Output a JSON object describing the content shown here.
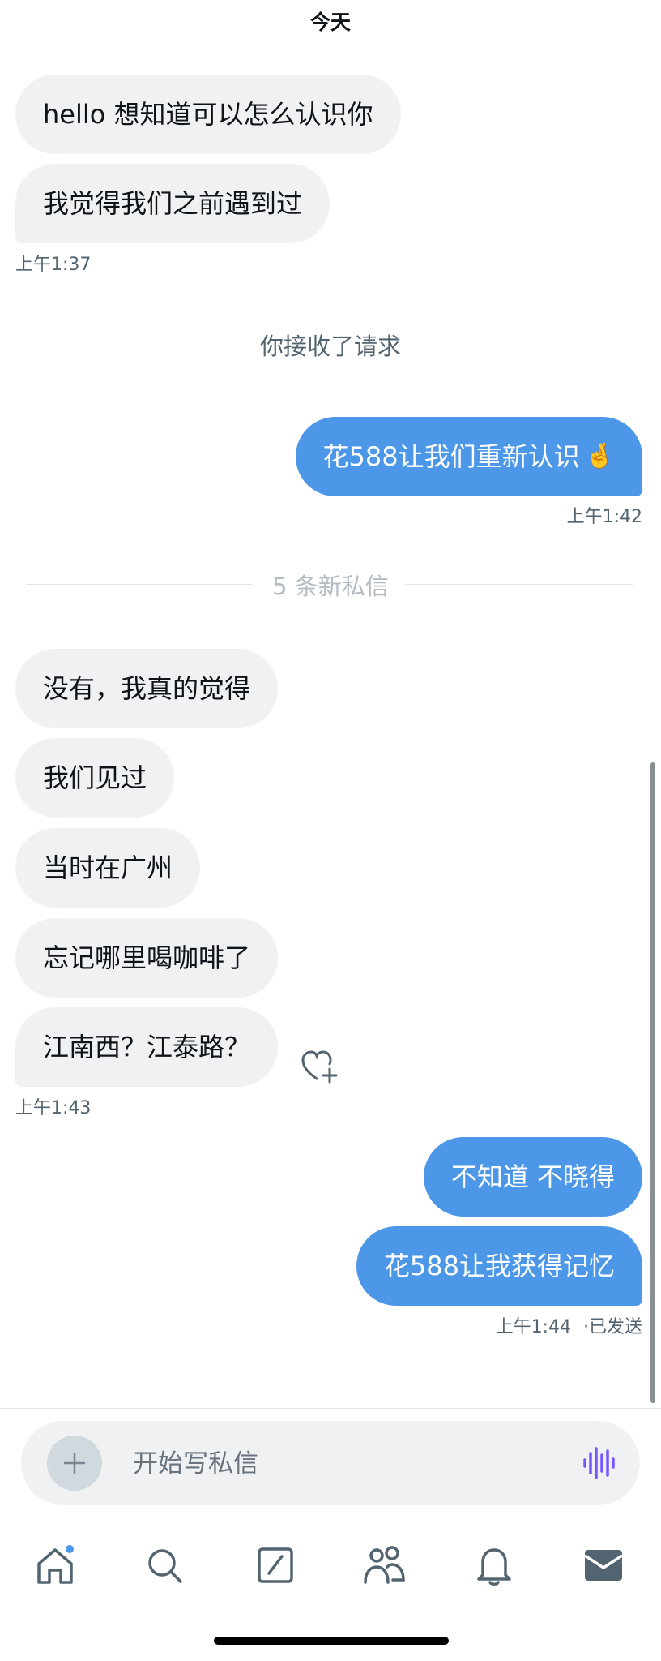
{
  "header": {
    "day_label": "今天"
  },
  "messages_group1": {
    "incoming": [
      "hello  想知道可以怎么认识你",
      "我觉得我们之前遇到过"
    ],
    "time": "上午1:37"
  },
  "system_message": "你接收了请求",
  "outgoing_group1": {
    "text": "花588让我们重新认识",
    "emoji": "🤞",
    "time": "上午1:42"
  },
  "new_messages_divider": "5 条新私信",
  "messages_group2": {
    "incoming": [
      "没有，我真的觉得",
      "我们见过",
      "当时在广州",
      "忘记哪里喝咖啡了",
      "江南西？江泰路？"
    ],
    "time": "上午1:43"
  },
  "outgoing_group2": {
    "messages": [
      "不知道 不晓得",
      "花588让我获得记忆"
    ],
    "time": "上午1:44",
    "status": "·已发送"
  },
  "composer": {
    "placeholder": "开始写私信"
  },
  "colors": {
    "accent": "#4c97e8",
    "incoming_bg": "#eff1f3",
    "voice": "#7856ff"
  },
  "nav": {
    "icons": [
      "home-icon",
      "search-icon",
      "compose-icon",
      "communities-icon",
      "notifications-icon",
      "messages-icon"
    ]
  }
}
